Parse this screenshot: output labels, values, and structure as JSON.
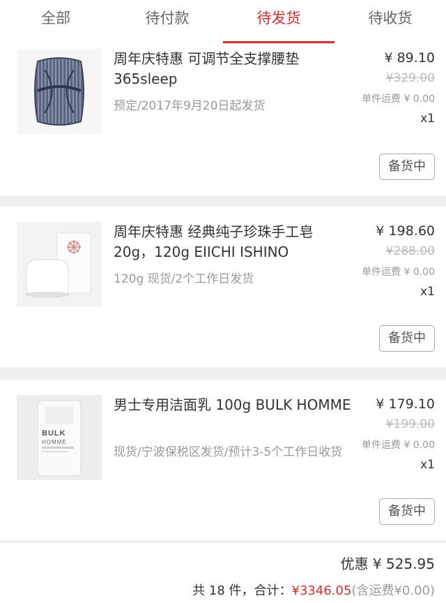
{
  "tabs": [
    {
      "label": "全部",
      "active": false
    },
    {
      "label": "待付款",
      "active": false
    },
    {
      "label": "待发货",
      "active": true
    },
    {
      "label": "待收货",
      "active": false
    }
  ],
  "items": [
    {
      "title": "周年庆特惠 可调节全支撑腰垫 365sleep",
      "note": "预定/2017年9月20日起发货",
      "price": "¥ 89.10",
      "original_price": "¥329.00",
      "shipping": "单件运费 ¥ 0.00",
      "quantity": "x1",
      "status_button": "备货中",
      "image": "cushion-image"
    },
    {
      "title": "周年庆特惠 经典纯子珍珠手工皂 20g，120g EIICHI ISHINO",
      "note": "120g 现货/2个工作日发货",
      "price": "¥ 198.60",
      "original_price": "¥288.00",
      "shipping": "单件运费 ¥ 0.00",
      "quantity": "x1",
      "status_button": "备货中",
      "image": "soap-image"
    },
    {
      "title": "男士专用洁面乳 100g BULK HOMME",
      "note": "现货/宁波保税区发货/预计3-5个工作日收货",
      "price": "¥ 179.10",
      "original_price": "¥199.00",
      "shipping": "单件运费 ¥ 0.00",
      "quantity": "x1",
      "status_button": "备货中",
      "image": "cleanser-image",
      "image_text": [
        "BULK",
        "HOMME"
      ]
    }
  ],
  "summary": {
    "discount": "优惠 ¥ 525.95",
    "total_prefix": "共 18 件，合计：",
    "total_amount": "¥3346.05",
    "total_suffix": "(含运费¥0.00)"
  },
  "colors": {
    "accent": "#d32f2f",
    "background": "#f0f0f0"
  }
}
